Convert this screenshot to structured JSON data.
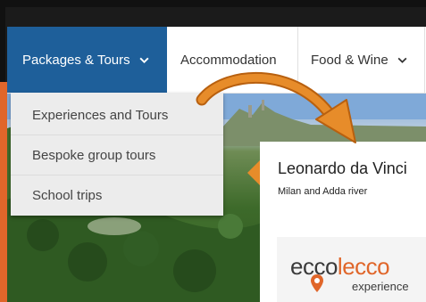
{
  "nav": {
    "items": [
      {
        "label": "Packages & Tours",
        "has_chevron": true,
        "active": true
      },
      {
        "label": "Accommodation",
        "has_chevron": false,
        "active": false
      },
      {
        "label": "Food & Wine",
        "has_chevron": true,
        "active": false
      }
    ]
  },
  "dropdown": {
    "items": [
      {
        "label": "Experiences and Tours"
      },
      {
        "label": "Bespoke group tours"
      },
      {
        "label": "School trips"
      }
    ]
  },
  "card": {
    "title": "Leonardo da Vinci",
    "subtitle": "Milan and Adda river"
  },
  "logo": {
    "word_dark": "ecco",
    "word_orange": "lecco",
    "sub": "experience",
    "text": "eccolecco experience"
  },
  "colors": {
    "nav_active_bg": "#1e5f9a",
    "accent_orange": "#e78c2a",
    "logo_orange": "#e0662a"
  },
  "icons": [
    "chevron-down-icon",
    "curved-arrow-icon",
    "location-pin-icon"
  ]
}
